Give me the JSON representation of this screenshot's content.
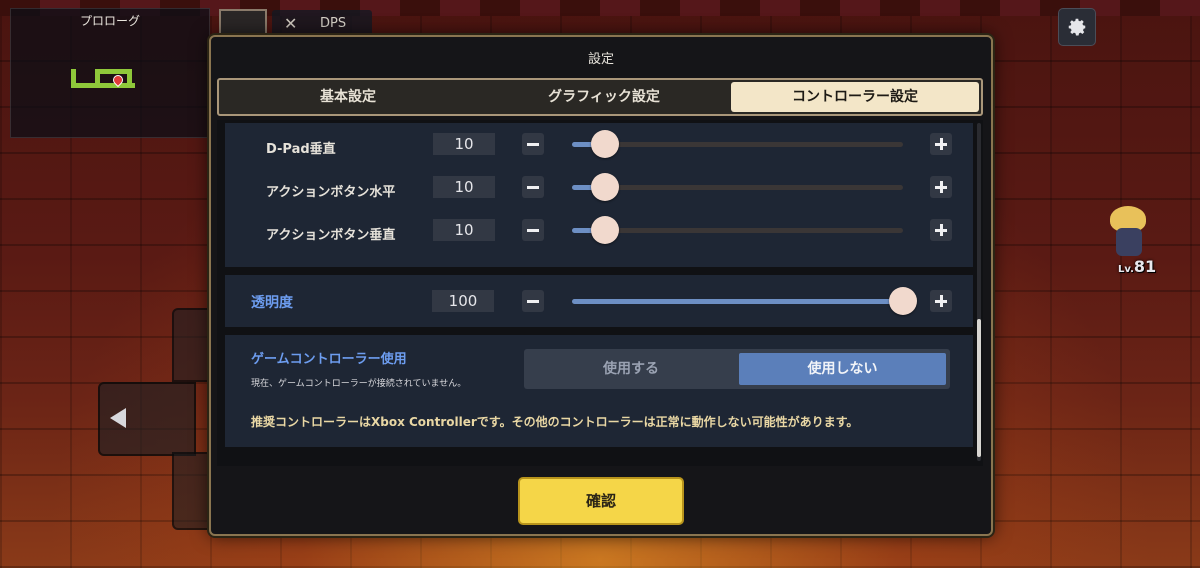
{
  "minimap": {
    "title": "プロローグ"
  },
  "hud": {
    "dps_label": "DPS"
  },
  "hero": {
    "level_prefix": "Lv.",
    "level": "81"
  },
  "dialog": {
    "title": "設定",
    "tabs": [
      {
        "label": "基本設定",
        "active": false
      },
      {
        "label": "グラフィック設定",
        "active": false
      },
      {
        "label": "コントローラー設定",
        "active": true
      }
    ],
    "sliders": [
      {
        "label": "D-Pad垂直",
        "value": "10",
        "level": 0.1
      },
      {
        "label": "アクションボタン水平",
        "value": "10",
        "level": 0.1
      },
      {
        "label": "アクションボタン垂直",
        "value": "10",
        "level": 0.1
      }
    ],
    "opacity": {
      "label": "透明度",
      "value": "100",
      "level": 1.0
    },
    "gamepad": {
      "label": "ゲームコントローラー使用",
      "status": "現在、ゲームコントローラーが接続されていません。",
      "options": [
        {
          "label": "使用する",
          "selected": false
        },
        {
          "label": "使用しない",
          "selected": true
        }
      ],
      "note": "推奨コントローラーはXbox Controllerです。その他のコントローラーは正常に動作しない可能性があります。"
    },
    "confirm_label": "確認"
  },
  "colors": {
    "accent_blue": "#5b7fba",
    "label_blue": "#6d9df0",
    "confirm_yellow": "#f5d648",
    "active_tab": "#f3e6c8",
    "warning_text": "#e9d7a4"
  }
}
